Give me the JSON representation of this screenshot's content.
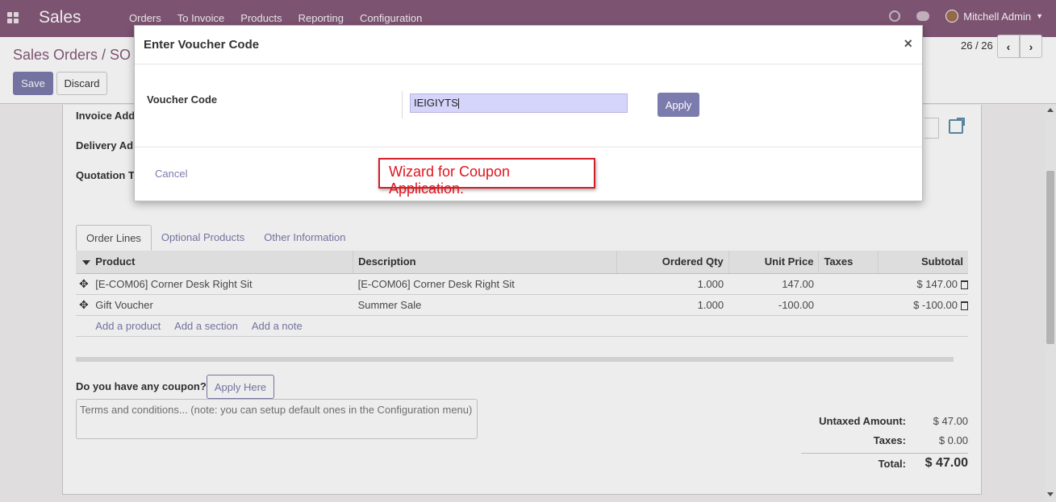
{
  "navbar": {
    "app_name": "Sales",
    "menu": [
      "Orders",
      "To Invoice",
      "Products",
      "Reporting",
      "Configuration"
    ],
    "user_name": "Mitchell Admin"
  },
  "control_panel": {
    "breadcrumb": "Sales Orders / SO",
    "save_label": "Save",
    "discard_label": "Discard",
    "pager": "26 / 26"
  },
  "form": {
    "labels": {
      "invoice_address": "Invoice Add",
      "delivery_address": "Delivery Ad",
      "quotation_template": "Quotation T"
    },
    "tabs": [
      "Order Lines",
      "Optional Products",
      "Other Information"
    ],
    "table": {
      "headers": [
        "Product",
        "Description",
        "Ordered Qty",
        "Unit Price",
        "Taxes",
        "Subtotal"
      ],
      "rows": [
        {
          "product": "[E-COM06] Corner Desk Right Sit",
          "description": "[E-COM06] Corner Desk Right Sit",
          "qty": "1.000",
          "price": "147.00",
          "taxes": "",
          "subtotal": "$ 147.00"
        },
        {
          "product": "Gift Voucher",
          "description": "Summer Sale",
          "qty": "1.000",
          "price": "-100.00",
          "taxes": "",
          "subtotal": "$ -100.00"
        }
      ],
      "add_links": [
        "Add a product",
        "Add a section",
        "Add a note"
      ]
    },
    "coupon_label": "Do you have any coupon?",
    "apply_here_label": "Apply Here",
    "terms_placeholder": "Terms and conditions... (note: you can setup default ones in the Configuration menu)",
    "totals": {
      "untaxed_label": "Untaxed Amount:",
      "untaxed_value": "$ 47.00",
      "taxes_label": "Taxes:",
      "taxes_value": "$ 0.00",
      "total_label": "Total:",
      "total_value": "$ 47.00"
    }
  },
  "modal": {
    "title": "Enter Voucher Code",
    "close_glyph": "×",
    "voucher_label": "Voucher Code",
    "voucher_value": "IEIGIYTS",
    "apply_label": "Apply",
    "cancel_label": "Cancel",
    "annotation": "Wizard for Coupon Application."
  },
  "colors": {
    "brand": "#875a7b",
    "accent": "#7c7bad",
    "annotation_red": "#e0141e"
  }
}
